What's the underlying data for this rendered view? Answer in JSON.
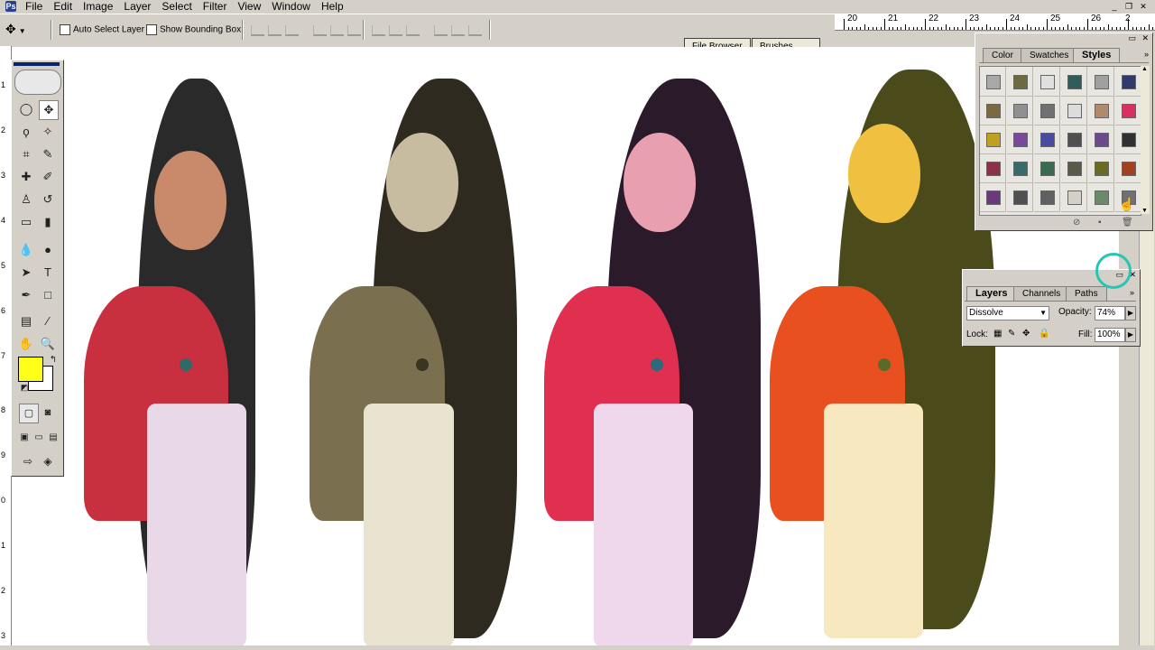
{
  "app": {
    "icon": "photoshop-icon"
  },
  "menu": [
    "File",
    "Edit",
    "Image",
    "Layer",
    "Select",
    "Filter",
    "View",
    "Window",
    "Help"
  ],
  "window_controls": {
    "minimize": "_",
    "restore": "❐",
    "close": "✕"
  },
  "options_bar": {
    "auto_select_label": "Auto Select Layer",
    "bounding_box_label": "Show Bounding Box",
    "auto_select_checked": false,
    "bounding_box_checked": false
  },
  "palette_well": {
    "tabs": [
      "File Browser",
      "Brushes"
    ]
  },
  "ruler_top": {
    "labels": [
      "20",
      "21",
      "22",
      "23",
      "24",
      "25",
      "26",
      "2"
    ]
  },
  "ruler_left": {
    "labels": [
      "1",
      "2",
      "3",
      "4",
      "5",
      "6",
      "7",
      "8",
      "9",
      "0",
      "1",
      "2",
      "3"
    ]
  },
  "toolbox": {
    "tools": [
      {
        "name": "marquee-icon",
        "glyph": "◯"
      },
      {
        "name": "move-icon",
        "glyph": "✥"
      },
      {
        "name": "lasso-icon",
        "glyph": "ϙ"
      },
      {
        "name": "magic-wand-icon",
        "glyph": "✧"
      },
      {
        "name": "crop-icon",
        "glyph": "⌗"
      },
      {
        "name": "slice-icon",
        "glyph": "✎"
      },
      {
        "name": "healing-brush-icon",
        "glyph": "✚"
      },
      {
        "name": "brush-icon",
        "glyph": "✐"
      },
      {
        "name": "clone-stamp-icon",
        "glyph": "♙"
      },
      {
        "name": "history-brush-icon",
        "glyph": "↺"
      },
      {
        "name": "eraser-icon",
        "glyph": "▭"
      },
      {
        "name": "gradient-icon",
        "glyph": "▮"
      },
      {
        "name": "blur-icon",
        "glyph": "💧"
      },
      {
        "name": "burn-icon",
        "glyph": "●"
      },
      {
        "name": "path-selection-icon",
        "glyph": "➤"
      },
      {
        "name": "type-icon",
        "glyph": "T"
      },
      {
        "name": "pen-icon",
        "glyph": "✒"
      },
      {
        "name": "rectangle-icon",
        "glyph": "□"
      },
      {
        "name": "notes-icon",
        "glyph": "▤"
      },
      {
        "name": "eyedropper-icon",
        "glyph": "⁄"
      },
      {
        "name": "hand-icon",
        "glyph": "✋"
      },
      {
        "name": "zoom-icon",
        "glyph": "🔍"
      }
    ],
    "foreground_color": "#ffff1a",
    "background_color": "#ffffff"
  },
  "styles_panel": {
    "tabs": [
      "Color",
      "Swatches",
      "Styles"
    ],
    "active_tab": "Styles",
    "swatches": [
      "#a8a8a8",
      "#6e6a40",
      "#e0e0e0",
      "#2f5b5b",
      "#a0a0a0",
      "#303a6a",
      "#7a6a40",
      "#909090",
      "#707070",
      "#dcdcdc",
      "#b08a6a",
      "#d83060",
      "#c0a020",
      "#7a4a9a",
      "#4a4aa0",
      "#505050",
      "#6a4a8a",
      "#303030",
      "#8a3048",
      "#3a6a6a",
      "#3a6a50",
      "#5a5a4a",
      "#6a6a20",
      "#a04020",
      "#6a3a7a",
      "#505050",
      "#606060",
      "#d4d0c8",
      "#6a8a6a",
      "#707070"
    ]
  },
  "layers_panel": {
    "tabs": [
      "Layers",
      "Channels",
      "Paths"
    ],
    "active_tab": "Layers",
    "blend_mode": "Dissolve",
    "opacity_label": "Opacity:",
    "opacity_value": "74%",
    "lock_label": "Lock:",
    "fill_label": "Fill:",
    "fill_value": "100%"
  },
  "figures": [
    {
      "name": "figure-dissolve",
      "hair": "#2a2a2a",
      "skin": "#c88a6a",
      "top": "#c83040",
      "skirt": "#e8d8e8"
    },
    {
      "name": "figure-sepia",
      "hair": "#2e2a20",
      "skin": "#c8bca0",
      "top": "#7a7050",
      "skirt": "#e8e4d0"
    },
    {
      "name": "figure-pink",
      "hair": "#2a1a2a",
      "skin": "#e8a0b0",
      "top": "#e03050",
      "skirt": "#f0d8ec"
    },
    {
      "name": "figure-yellow",
      "hair": "#4a4a1a",
      "skin": "#f0c040",
      "top": "#e85020",
      "skirt": "#f8e8c0"
    }
  ]
}
